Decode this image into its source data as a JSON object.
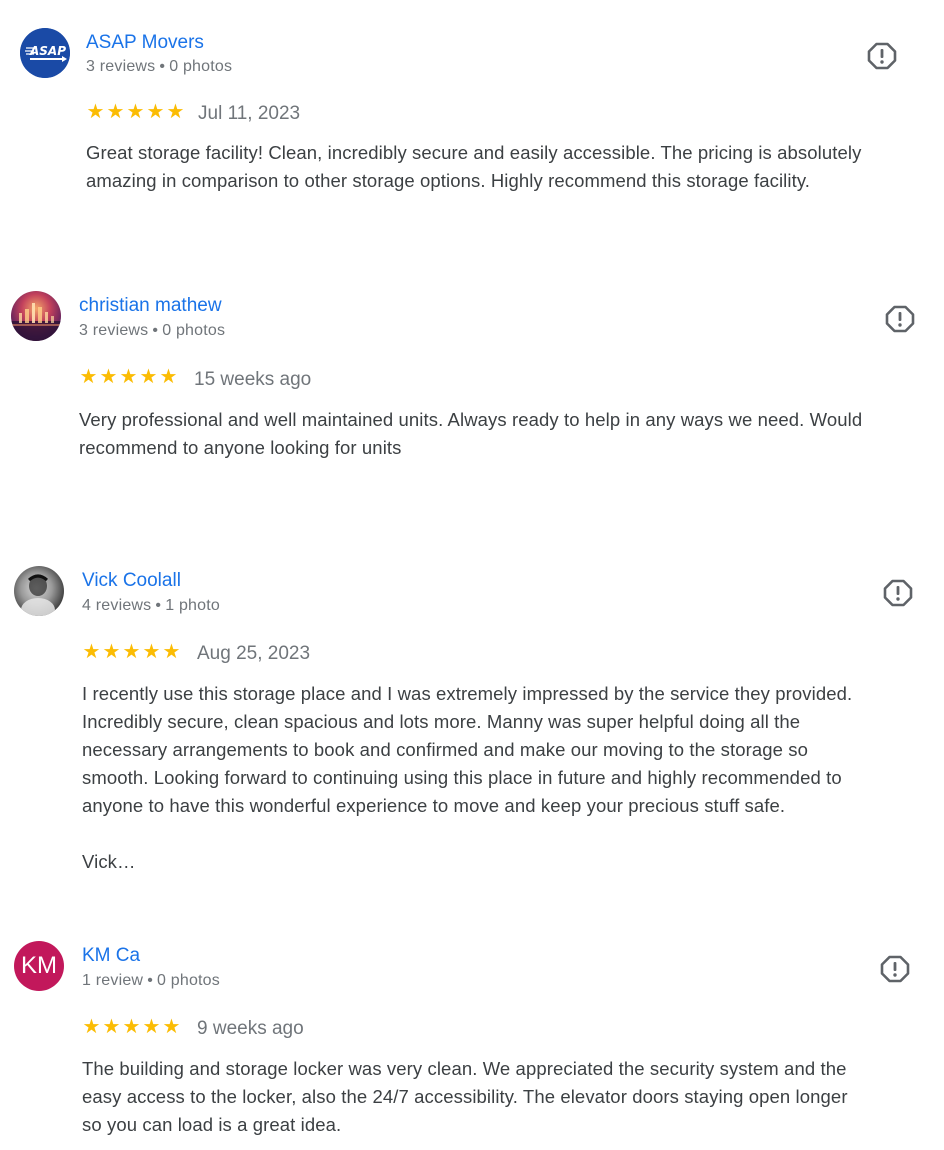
{
  "reviews": [
    {
      "name": "ASAP Movers",
      "reviews_count": "3 reviews",
      "photos_count": "0 photos",
      "avatar_text": "ASAP",
      "rating": 5,
      "stars": "★★★★★",
      "date": "Jul 11, 2023",
      "text": "Great storage facility! Clean, incredibly secure and easily accessible. The pricing is absolutely\namazing in comparison to other storage options. Highly recommend this storage facility."
    },
    {
      "name": "christian mathew",
      "reviews_count": "3 reviews",
      "photos_count": "0 photos",
      "rating": 5,
      "stars": "★★★★★",
      "date": "15 weeks ago",
      "text": "Very professional and well maintained units. Always ready to help in any ways we need. Would\nrecommend to anyone looking for units"
    },
    {
      "name": "Vick Coolall",
      "reviews_count": "4 reviews",
      "photos_count": "1 photo",
      "rating": 5,
      "stars": "★★★★★",
      "date": "Aug 25, 2023",
      "text": "I recently use this storage place and I was extremely impressed by the service they provided.\nIncredibly secure, clean spacious and lots more. Manny was super helpful doing all the\nnecessary arrangements to book and confirmed and make our moving to the storage so\nsmooth. Looking forward to continuing using this place in future and highly recommended to\nanyone to have this wonderful experience to move and keep your precious stuff safe.\n\nVick…"
    },
    {
      "name": "KM Ca",
      "reviews_count": "1 review",
      "photos_count": "0 photos",
      "avatar_text": "KM",
      "rating": 5,
      "stars": "★★★★★",
      "date": "9 weeks ago",
      "text": "The building and storage locker was very clean. We appreciated the security system and the\neasy access to the locker, also the 24/7 accessibility. The elevator doors staying open longer\nso you can load is a great idea."
    }
  ],
  "separator": "•",
  "colors": {
    "name_link": "#1a73e8",
    "star": "#fbbc04",
    "muted_text": "#70757a",
    "body_text": "#3c4043",
    "km_avatar": "#c2185b",
    "asap_avatar": "#1a4aa6"
  },
  "icons": {
    "report": "report-flag-icon",
    "star": "star-icon"
  }
}
